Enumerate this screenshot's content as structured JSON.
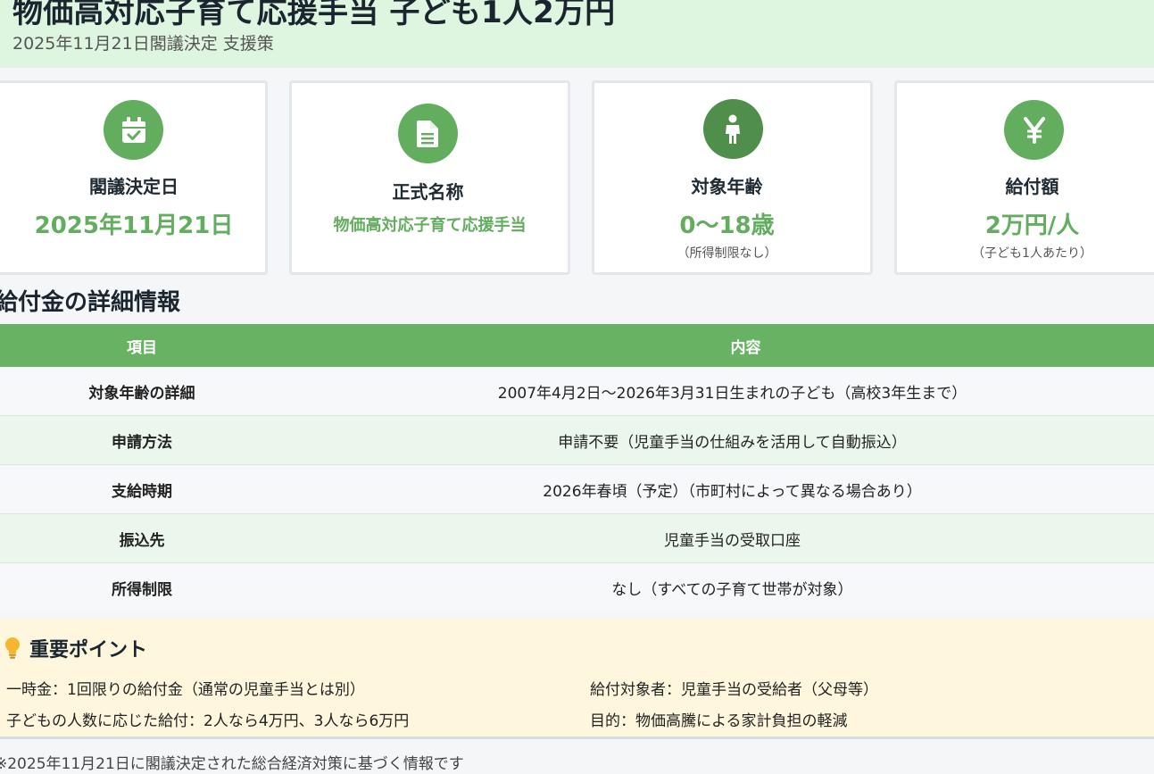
{
  "header": {
    "title": "物価高対応子育て応援手当 子ども1人2万円",
    "subtitle": "2025年11月21日閣議決定 支援策"
  },
  "cards": [
    {
      "icon": "calendar-check-icon",
      "label": "閣議決定日",
      "value": "2025年11月21日",
      "note": ""
    },
    {
      "icon": "document-icon",
      "label": "正式名称",
      "value": "物価高対応子育て応援手当",
      "note": ""
    },
    {
      "icon": "child-icon",
      "label": "対象年齢",
      "value": "0〜18歳",
      "note": "（所得制限なし）"
    },
    {
      "icon": "yen-icon",
      "label": "給付額",
      "value": "2万円/人",
      "note": "（子ども1人あたり）"
    }
  ],
  "details": {
    "title": "給付金の詳細情報",
    "headers": [
      "項目",
      "内容"
    ],
    "rows": [
      [
        "対象年齢の詳細",
        "2007年4月2日〜2026年3月31日生まれの子ども（高校3年生まで）"
      ],
      [
        "申請方法",
        "申請不要（児童手当の仕組みを活用して自動振込）"
      ],
      [
        "支給時期",
        "2026年春頃（予定）（市町村によって異なる場合あり）"
      ],
      [
        "振込先",
        "児童手当の受取口座"
      ],
      [
        "所得制限",
        "なし（すべての子育て世帯が対象）"
      ]
    ]
  },
  "points": {
    "title": "重要ポイント",
    "icon": "lightbulb-icon",
    "items": [
      "一時金：1回限りの給付金（通常の児童手当とは別）",
      "給付対象者：児童手当の受給者（父母等）",
      "子どもの人数に応じた給付：2人なら4万円、3人なら6万円",
      "目的：物価高騰による家計負担の軽減"
    ]
  },
  "footer": {
    "note": "※2025年11月21日に閣議決定された総合経済対策に基づく情報です"
  },
  "colors": {
    "accent": "#62ad5e",
    "header_bg": "#def5e0",
    "points_bg": "#fef7de"
  }
}
